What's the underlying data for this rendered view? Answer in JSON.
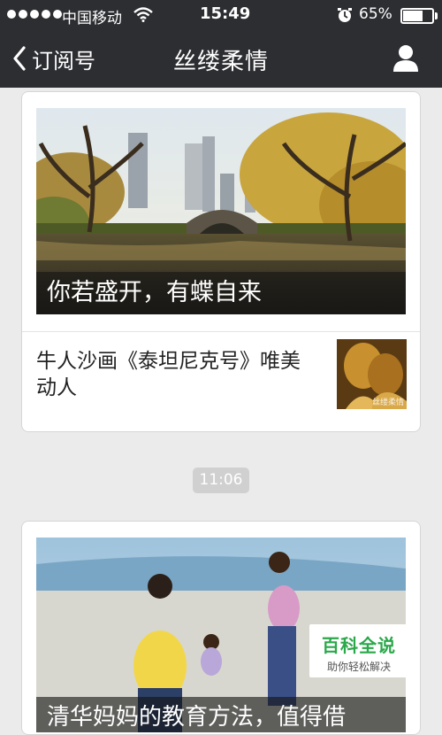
{
  "status_bar": {
    "carrier": "中国移动",
    "time": "15:49",
    "battery": "65%"
  },
  "nav": {
    "back_label": "订阅号",
    "title": "丝缕柔情"
  },
  "articles": [
    {
      "hero_caption": "你若盛开，有蝶自来",
      "sub_title": "牛人沙画《泰坦尼克号》唯美动人",
      "thumb_watermark": "丝缕柔情"
    },
    {
      "hero_caption": "清华妈妈的教育方法，值得借"
    }
  ],
  "timestamp": "11:06",
  "watermark": {
    "title": "百科全说",
    "subtitle": "助你轻松解决"
  },
  "icons": {
    "back": "chevron-left-icon",
    "profile": "person-icon",
    "wifi": "wifi-icon",
    "alarm": "alarm-icon",
    "battery": "battery-icon"
  }
}
